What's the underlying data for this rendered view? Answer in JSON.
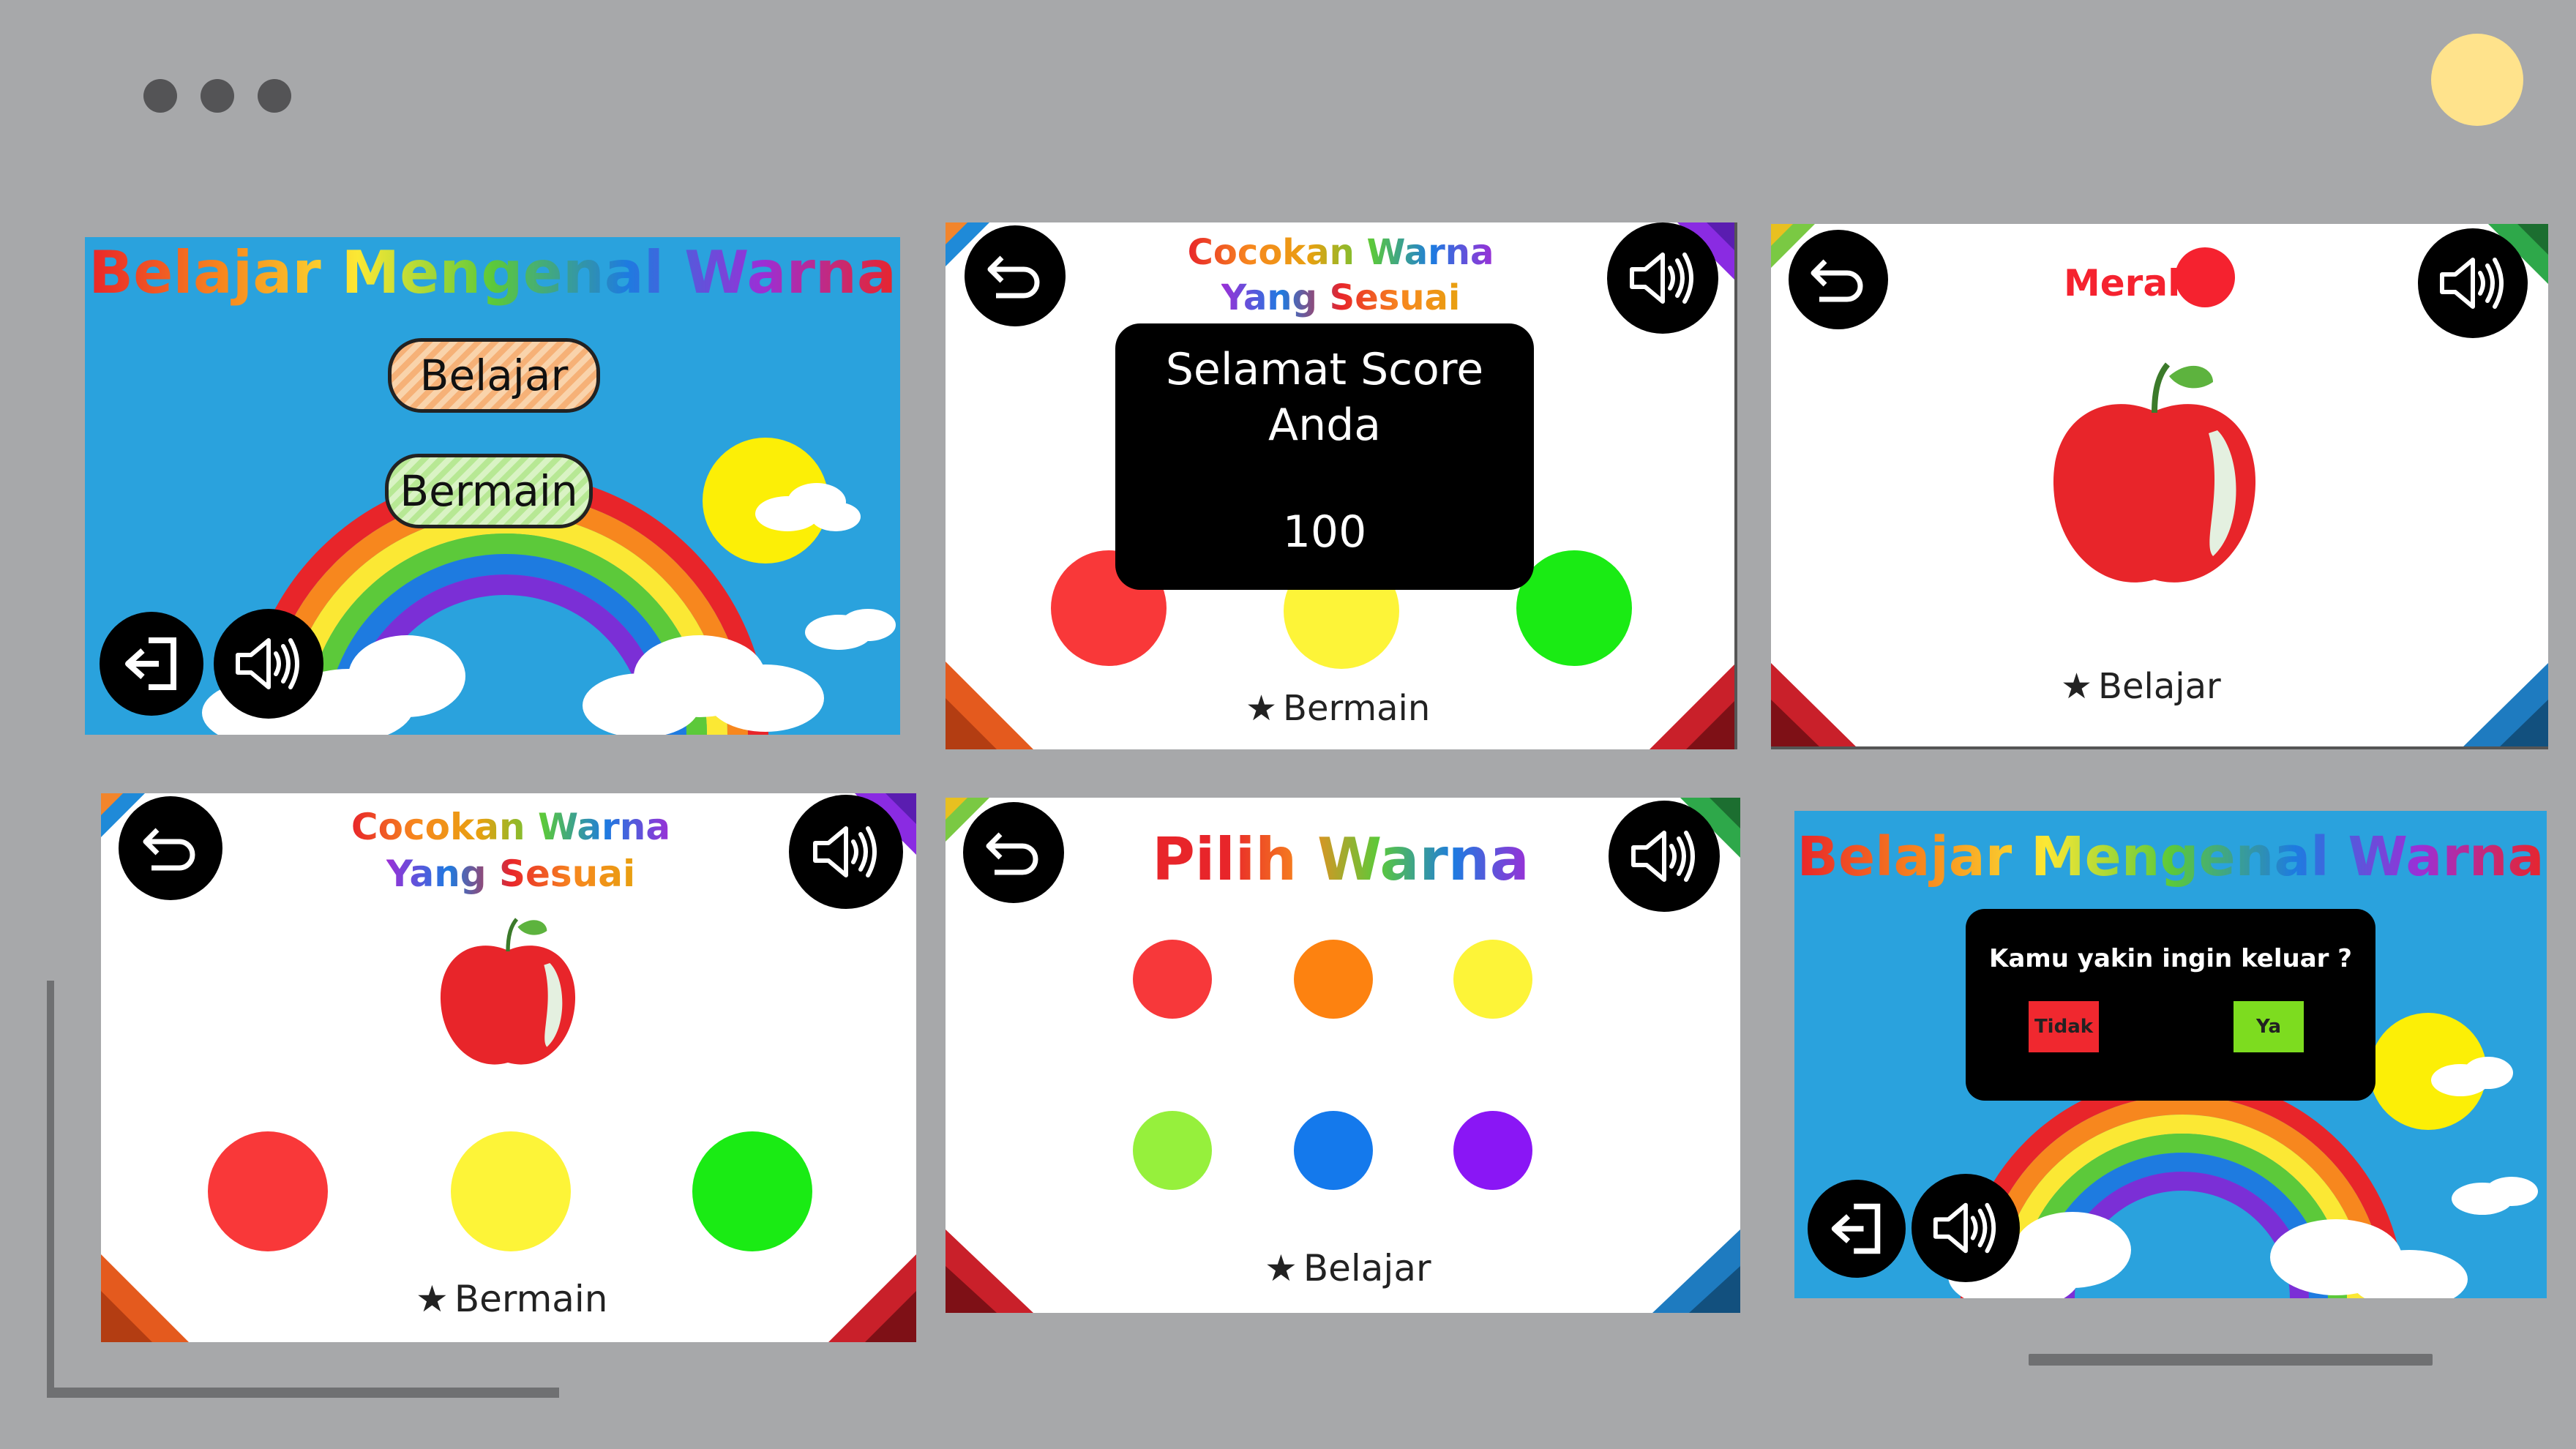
{
  "window": {
    "controls": [
      "dot",
      "dot",
      "dot"
    ],
    "accent_circle_color": "#ffe38c"
  },
  "panels": {
    "menu": {
      "title": "Belajar Mengenal Warna",
      "learn_button": "Belajar",
      "play_button": "Bermain",
      "exit_icon": "exit-icon",
      "sound_icon": "speaker-icon"
    },
    "score": {
      "title_line1": "Cocokan Warna",
      "title_line2": "Yang Sesuai",
      "dialog_line1": "Selamat Score",
      "dialog_line2": "Anda",
      "score_value": "100",
      "footer": "Bermain",
      "colors": [
        "#f93839",
        "#fdf438",
        "#1aeb14"
      ]
    },
    "learn_red": {
      "color_name": "Merah",
      "color_hex": "#f5222f",
      "footer": "Belajar"
    },
    "match": {
      "title_line1": "Cocokan Warna",
      "title_line2": "Yang Sesuai",
      "footer": "Bermain",
      "colors": [
        "#f93839",
        "#fdf438",
        "#1aeb14"
      ]
    },
    "pick": {
      "title": "Pilih Warna",
      "footer": "Belajar",
      "colors": [
        "#f7383a",
        "#fd8210",
        "#fdf438",
        "#96f03c",
        "#1479ec",
        "#8a16f5"
      ]
    },
    "exit_confirm": {
      "title": "Belajar Mengenal Warna",
      "question": "Kamu yakin ingin keluar ?",
      "no_label": "Tidak",
      "yes_label": "Ya"
    }
  }
}
